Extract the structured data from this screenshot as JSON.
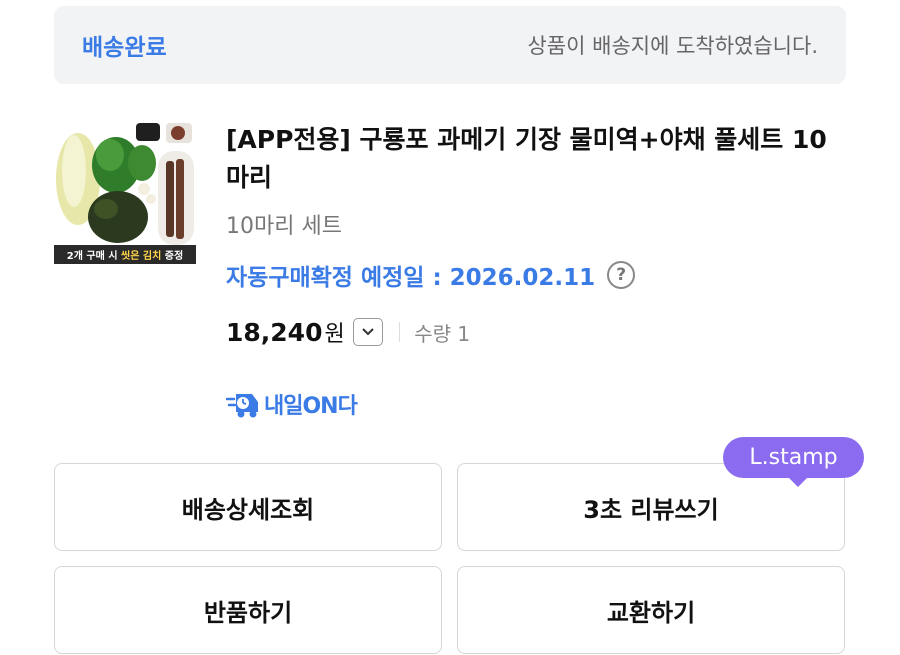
{
  "order_status": {
    "label": "배송완료",
    "description": "상품이 배송지에 도착하였습니다."
  },
  "product": {
    "title": "[APP전용] 구룡포 과메기 기장 물미역+야채 풀세트 10마리",
    "option": "10마리 세트",
    "auto_confirm": "자동구매확정 예정일 : 2026.02.11",
    "price": "18,240",
    "currency": "원",
    "quantity": "수량 1",
    "image_caption_parts": [
      "2개 구매 시 ",
      "씻은 김치",
      " 증정"
    ]
  },
  "delivery": {
    "label": "내일ON다"
  },
  "buttons": {
    "tracking": "배송상세조회",
    "review": "3초 리뷰쓰기",
    "return": "반품하기",
    "exchange": "교환하기"
  },
  "stamp": {
    "label": "L.stamp"
  },
  "colors": {
    "accent_blue": "#3b7be6",
    "stamp_purple": "#8b6cf0",
    "status_bg": "#f2f3f5"
  }
}
